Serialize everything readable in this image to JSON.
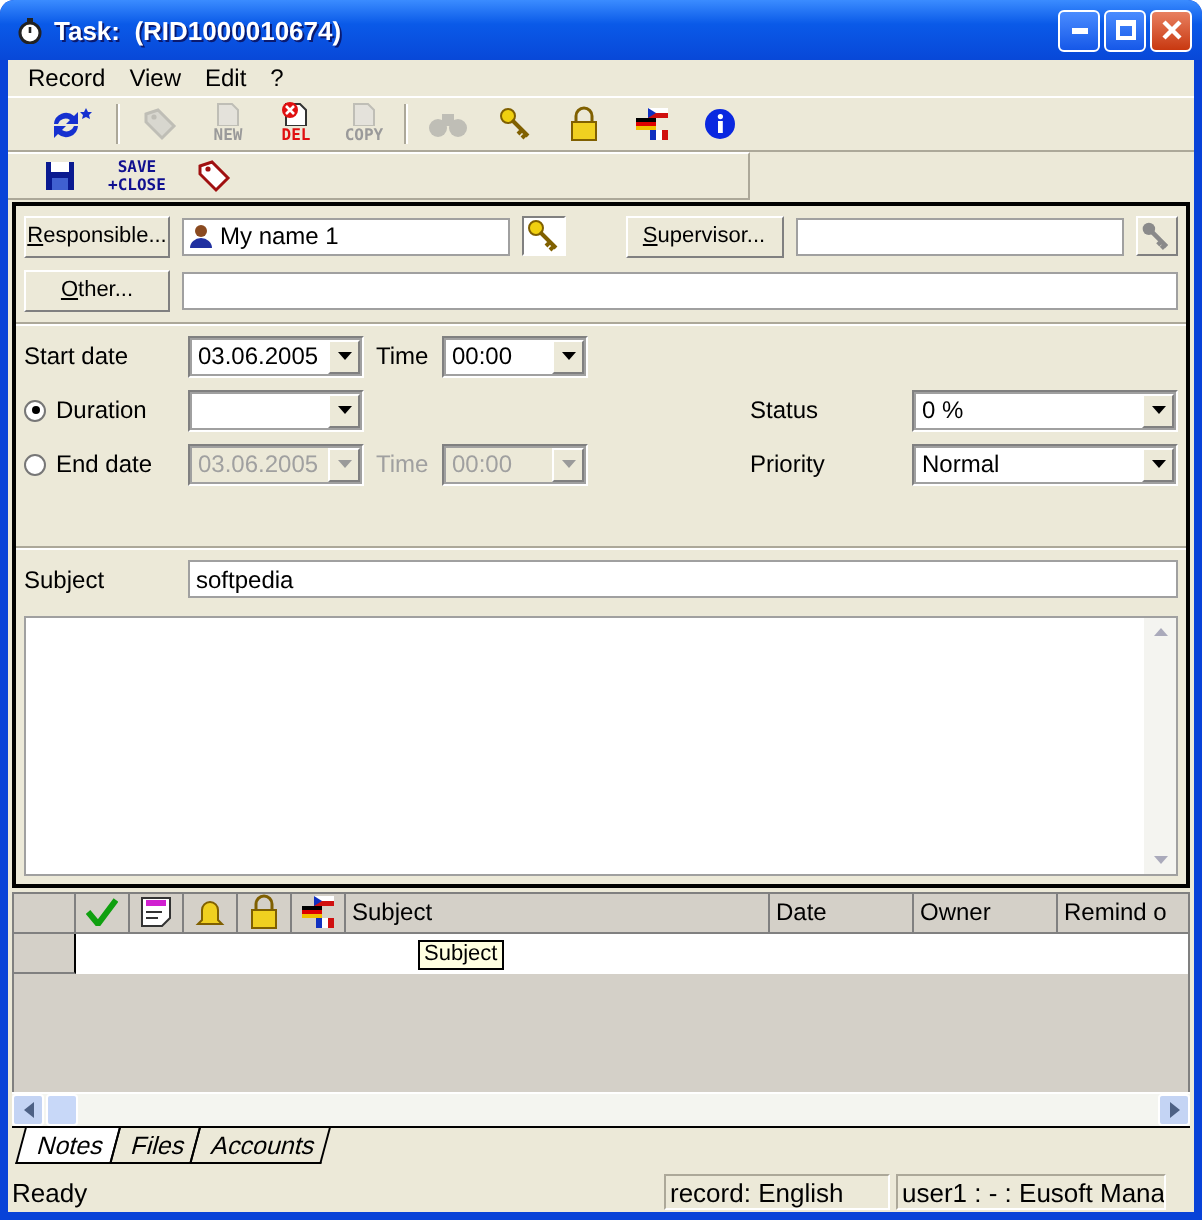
{
  "window": {
    "title": "Task:  (RID1000010674)"
  },
  "menu": [
    "Record",
    "View",
    "Edit",
    "?"
  ],
  "toolbar": [
    {
      "kind": "refresh",
      "disabled": false
    },
    {
      "kind": "tag",
      "disabled": true
    },
    {
      "kind": "new",
      "label": "NEW",
      "disabled": true
    },
    {
      "kind": "delete",
      "label": "DEL",
      "disabled": false
    },
    {
      "kind": "copy",
      "label": "COPY",
      "disabled": true
    },
    {
      "kind": "find",
      "disabled": true
    },
    {
      "kind": "key",
      "disabled": false
    },
    {
      "kind": "lock",
      "disabled": false
    },
    {
      "kind": "flags",
      "disabled": false
    },
    {
      "kind": "info",
      "disabled": false
    }
  ],
  "toolbar_2": [
    {
      "kind": "save"
    },
    {
      "kind": "save_close",
      "label": "SAVE",
      "label_2": "+CLOSE"
    },
    {
      "kind": "tag"
    }
  ],
  "form": {
    "responsible_button": "Responsible...",
    "responsible": "My name 1",
    "supervisor_button": "Supervisor...",
    "supervisor_pick_disabled": true,
    "other_button": "Other...",
    "start_date_label": "Start date",
    "start_date": "03.06.2005",
    "time_label": "Time",
    "start_time": "00:00",
    "duration": {
      "label": "Duration",
      "selected": true
    },
    "end_date": {
      "label": "End date",
      "selected": false,
      "date": "03.06.2005",
      "time_label": "Time",
      "time": "00:00"
    },
    "status_label": "Status",
    "status": "0 %",
    "priority_label": "Priority",
    "priority": "Normal",
    "subject_label": "Subject",
    "subject": "softpedia"
  },
  "grid": {
    "columns": [
      "Subject",
      "Date",
      "Owner",
      "Remind o"
    ],
    "tooltip": "Subject"
  },
  "tabs": [
    {
      "label": "Notes",
      "selected": true
    },
    {
      "label": "Files",
      "selected": false
    },
    {
      "label": "Accounts",
      "selected": false
    }
  ],
  "status_bar": [
    "Ready",
    "record: English",
    "user1 : - : Eusoft Mana"
  ]
}
